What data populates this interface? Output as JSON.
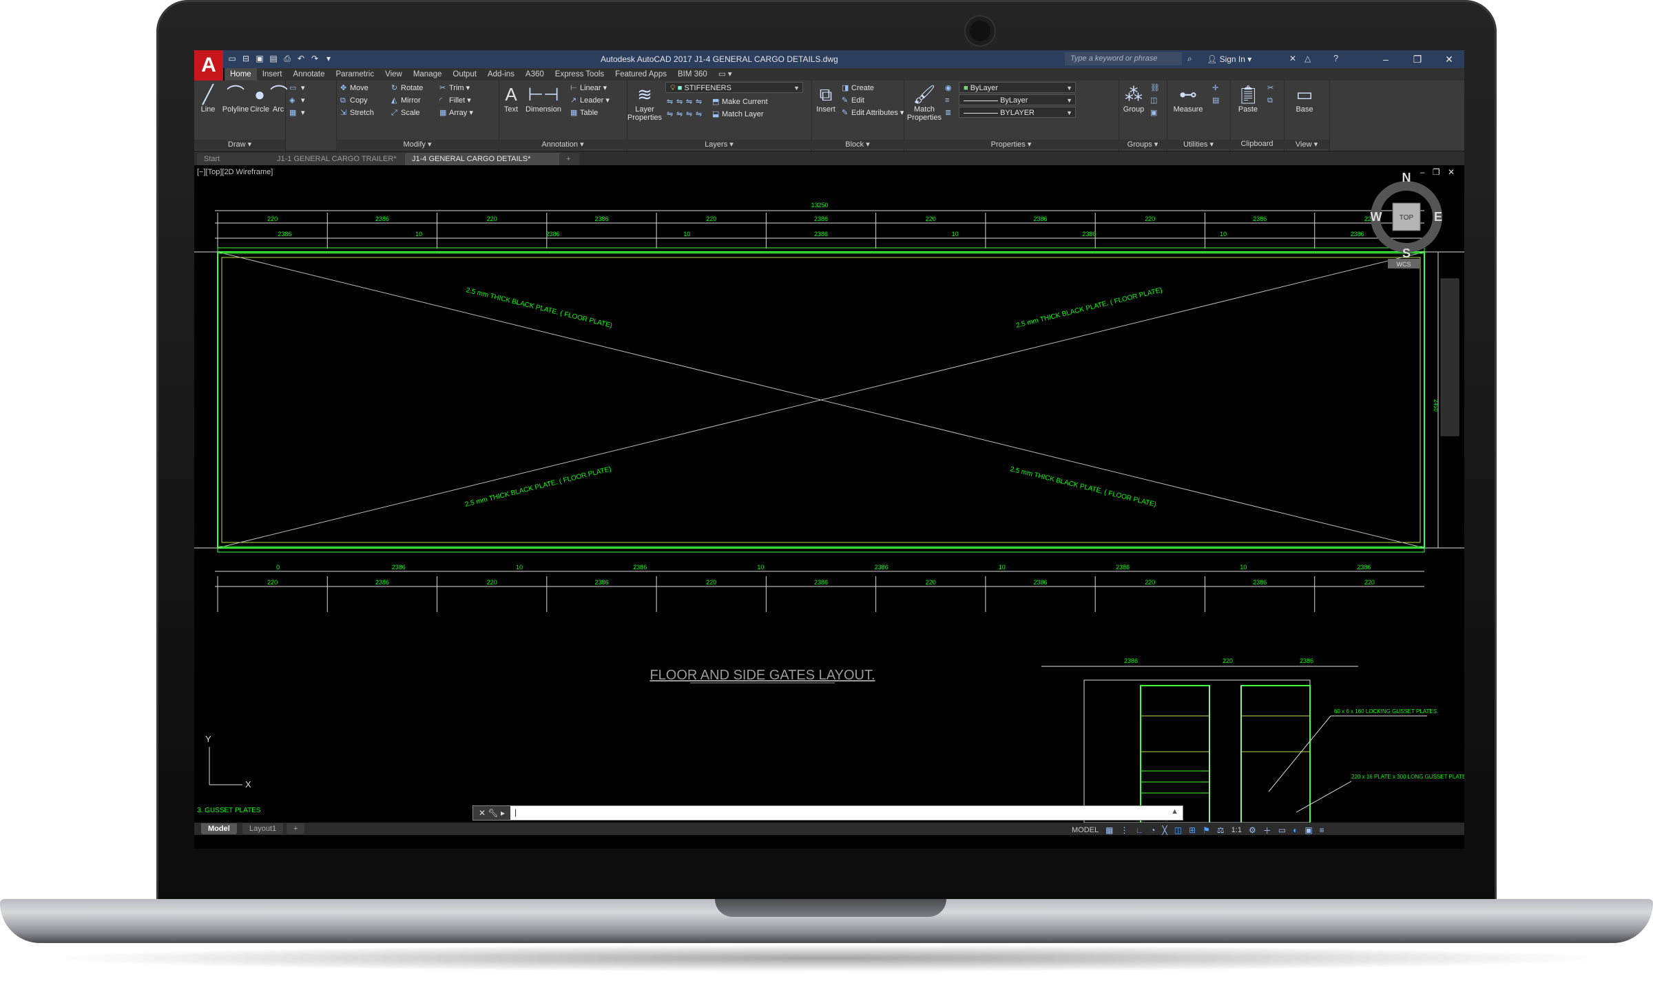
{
  "app": {
    "logo": "A",
    "title": "Autodesk AutoCAD 2017    J1-4 GENERAL CARGO DETAILS.dwg",
    "search_placeholder": "Type a keyword or phrase",
    "signin": "Sign In"
  },
  "ribbon_tabs": [
    "Home",
    "Insert",
    "Annotate",
    "Parametric",
    "View",
    "Manage",
    "Output",
    "Add-ins",
    "A360",
    "Express Tools",
    "Featured Apps",
    "BIM 360"
  ],
  "ribbon": {
    "draw": {
      "title": "Draw",
      "line": "Line",
      "polyline": "Polyline",
      "circle": "Circle",
      "arc": "Arc"
    },
    "modify": {
      "title": "Modify",
      "move": "Move",
      "rotate": "Rotate",
      "trim": "Trim",
      "copy": "Copy",
      "mirror": "Mirror",
      "fillet": "Fillet",
      "stretch": "Stretch",
      "scale": "Scale",
      "array": "Array"
    },
    "annotation": {
      "title": "Annotation",
      "text": "Text",
      "dimension": "Dimension",
      "linear": "Linear",
      "leader": "Leader",
      "table": "Table"
    },
    "layers": {
      "title": "Layers",
      "layer_properties_1": "Layer",
      "layer_properties_2": "Properties",
      "current_layer": "STIFFENERS",
      "make_current": "Make Current",
      "match_layer": "Match Layer"
    },
    "block": {
      "title": "Block",
      "insert": "Insert",
      "create": "Create",
      "edit": "Edit",
      "edit_attributes": "Edit Attributes"
    },
    "properties": {
      "title": "Properties",
      "match_1": "Match",
      "match_2": "Properties",
      "color": "ByLayer",
      "linetype": "ByLayer",
      "lineweight": "BYLAYER"
    },
    "groups": {
      "title": "Groups",
      "group": "Group"
    },
    "utilities": {
      "title": "Utilities",
      "measure": "Measure"
    },
    "clipboard": {
      "title": "Clipboard",
      "paste": "Paste"
    },
    "view": {
      "title": "View",
      "base": "Base"
    }
  },
  "doc_tabs": [
    "Start",
    "J1-1 GENERAL CARGO TRAILER*",
    "J1-4 GENERAL CARGO DETAILS*"
  ],
  "viewport": {
    "label": "[−][Top][2D Wireframe]",
    "compass": {
      "n": "N",
      "s": "S",
      "e": "E",
      "w": "W",
      "top": "TOP",
      "wcs": "WCS"
    }
  },
  "drawing": {
    "overall_dim": "13250",
    "top_outer_dims": [
      "220",
      "2386",
      "220",
      "2386",
      "220",
      "2386",
      "220",
      "2386",
      "220",
      "2386",
      "220"
    ],
    "top_inner_dims": [
      "2386",
      "10",
      "2386",
      "10",
      "2386",
      "10",
      "2386",
      "10",
      "2386"
    ],
    "bottom_inner_dims": [
      "0",
      "2386",
      "10",
      "2386",
      "10",
      "2386",
      "10",
      "2386",
      "10",
      "2386"
    ],
    "bottom_outer_dims": [
      "220",
      "2386",
      "220",
      "2386",
      "220",
      "2386",
      "220",
      "2386",
      "220",
      "2386",
      "220"
    ],
    "plate_label": "2.5 mm THICK BLACK PLATE. ( FLOOR PLATE)",
    "layout_title": "FLOOR  AND SIDE GATES LAYOUT.",
    "detail_dims": [
      "2386",
      "220",
      "2386"
    ],
    "detail_note_1": "60 x 6 x 160 LOCKING GUSSET PLATES.",
    "detail_note_2": "220 x 16 PLATE x 300 LONG GUSSET PLATES.",
    "corner_note": "3. GUSSET PLATES",
    "side_dim": "2450",
    "ucs_x": "X",
    "ucs_y": "Y"
  },
  "command_line": {
    "prompt": "|"
  },
  "layout_tabs": [
    "Model",
    "Layout1",
    "+"
  ],
  "status": {
    "model": "MODEL",
    "scale": "1:1"
  }
}
